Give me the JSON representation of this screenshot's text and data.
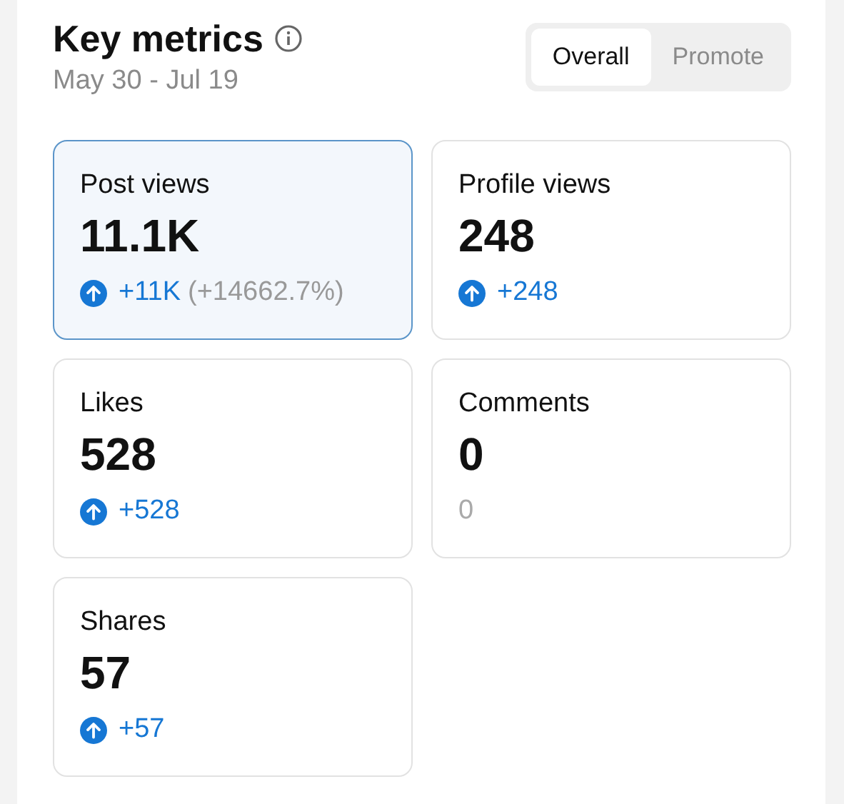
{
  "header": {
    "title": "Key metrics",
    "date_range": "May 30 - Jul 19"
  },
  "tabs": [
    {
      "label": "Overall",
      "selected": true
    },
    {
      "label": "Promote",
      "selected": false
    }
  ],
  "metrics": [
    {
      "label": "Post views",
      "value": "11.1K",
      "selected": true,
      "kind": "up",
      "change": "+11K",
      "percent": "(+14662.7%)"
    },
    {
      "label": "Profile views",
      "value": "248",
      "selected": false,
      "kind": "up",
      "change": "+248"
    },
    {
      "label": "Likes",
      "value": "528",
      "selected": false,
      "kind": "up",
      "change": "+528"
    },
    {
      "label": "Comments",
      "value": "0",
      "selected": false,
      "kind": "flat",
      "change": "0"
    },
    {
      "label": "Shares",
      "value": "57",
      "selected": false,
      "kind": "up",
      "change": "+57"
    }
  ]
}
